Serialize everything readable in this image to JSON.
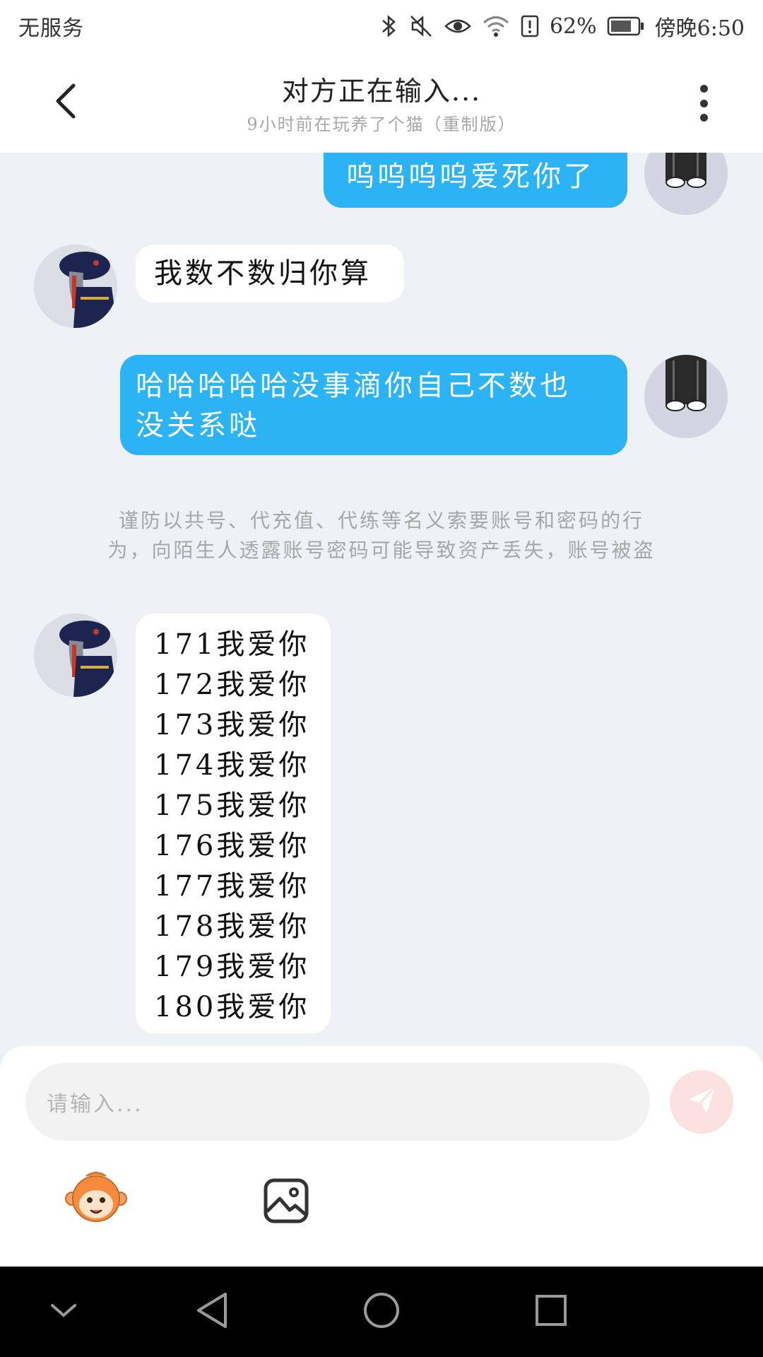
{
  "status": {
    "carrier": "无服务",
    "battery": "62%",
    "time": "傍晚6:50"
  },
  "header": {
    "title": "对方正在输入...",
    "subtitle": "9小时前在玩养了个猫（重制版）"
  },
  "messages": [
    {
      "side": "out",
      "text": "呜呜呜呜爱死你了"
    },
    {
      "side": "in",
      "text": "我数不数归你算"
    },
    {
      "side": "out",
      "lines": [
        "哈哈哈哈哈没事滴你自己不数也",
        "没关系哒"
      ]
    }
  ],
  "notice": {
    "line1": "谨防以共号、代充值、代练等名义索要账号和密码的行",
    "line2": "为，向陌生人透露账号密码可能导致资产丢失，账号被盗"
  },
  "count_message": [
    "171我爱你",
    "172我爱你",
    "173我爱你",
    "174我爱你",
    "175我爱你",
    "176我爱你",
    "177我爱你",
    "178我爱你",
    "179我爱你",
    "180我爱你"
  ],
  "input": {
    "placeholder": "请输入..."
  },
  "colors": {
    "outgoing_bubble": "#2bb3f5",
    "incoming_bubble": "#ffffff",
    "send_button": "#fce1e1"
  }
}
